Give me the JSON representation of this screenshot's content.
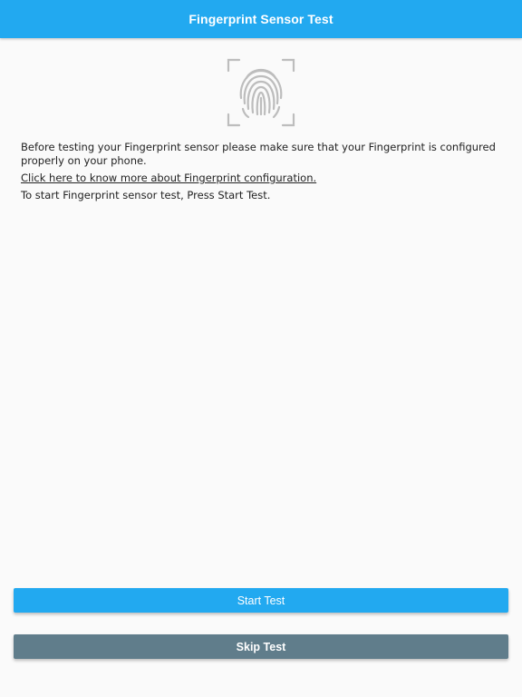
{
  "header": {
    "title": "Fingerprint Sensor Test"
  },
  "hero": {
    "icon": "fingerprint-icon"
  },
  "body": {
    "intro": "Before testing your Fingerprint sensor please make sure that your Fingerprint is configured properly on your phone.",
    "link_text": "Click here to know more about Fingerprint configuration.",
    "instruction": "To start Fingerprint sensor test, Press Start Test."
  },
  "actions": {
    "start_label": "Start Test",
    "skip_label": "Skip Test"
  },
  "colors": {
    "primary": "#22a9f0",
    "secondary": "#607d8b",
    "background": "#fafafa"
  }
}
